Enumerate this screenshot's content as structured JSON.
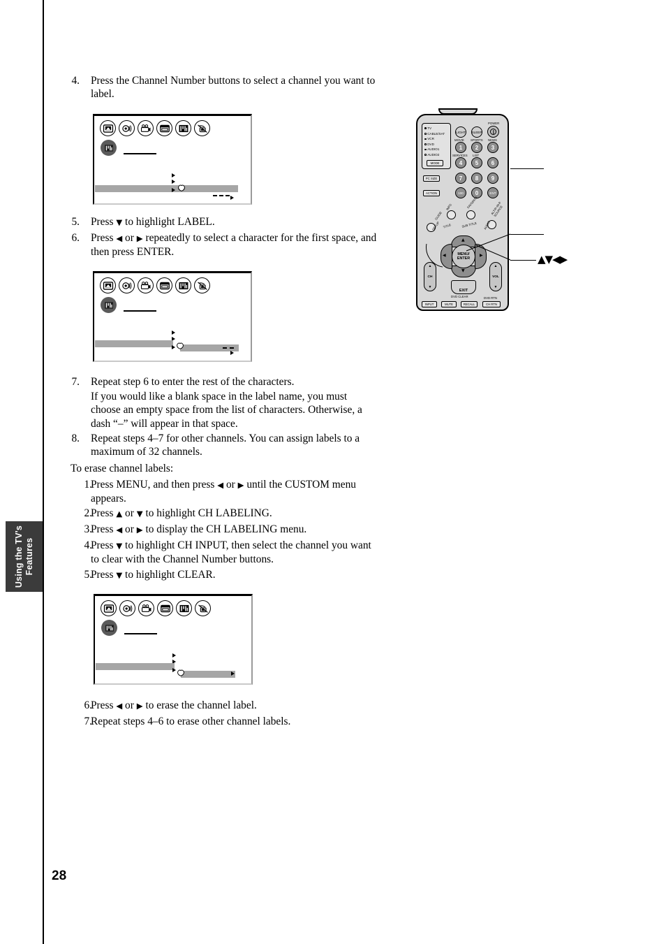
{
  "page": {
    "number": "28",
    "side_tab": "Using the TV's\nFeatures"
  },
  "steps_label": {
    "s4_num": "4.",
    "s4_text": "Press the Channel Number buttons to select a channel you want to label.",
    "s5_num": "5.",
    "s5_text_a": "Press ",
    "s5_arrow": "▼",
    "s5_text_b": " to highlight LABEL.",
    "s6_num": "6.",
    "s6_text_a": "Press ",
    "s6_arrow_l": "◀",
    "s6_text_b": " or ",
    "s6_arrow_r": "▶",
    "s6_text_c": " repeatedly to select a character for the first space, and then press ENTER.",
    "s7_num": "7.",
    "s7_text": "Repeat step 6 to enter the rest of the characters.",
    "s7_note": "If you would like a blank space in the label name, you must choose an empty space from the list of characters. Otherwise, a dash “–” will appear in that space.",
    "s8_num": "8.",
    "s8_text": "Repeat steps 4–7 for other channels. You can assign labels to a maximum of 32 channels."
  },
  "erase_section": {
    "heading": "To erase channel labels:",
    "e1_num": "1.",
    "e1_a": "Press MENU, and then press ",
    "e1_arrow_l": "◀",
    "e1_b": " or ",
    "e1_arrow_r": "▶",
    "e1_c": " until the CUSTOM menu appears.",
    "e2_num": "2.",
    "e2_a": "Press ",
    "e2_arrow_u": "▲",
    "e2_b": " or ",
    "e2_arrow_d": "▼",
    "e2_c": " to highlight CH LABELING.",
    "e3_num": "3.",
    "e3_a": "Press ",
    "e3_arrow_l": "◀",
    "e3_b": " or ",
    "e3_arrow_r": "▶",
    "e3_c": " to display the CH LABELING menu.",
    "e4_num": "4.",
    "e4_a": "Press ",
    "e4_arrow_d": "▼",
    "e4_b": " to highlight CH INPUT, then select the channel you want to clear with the Channel Number buttons.",
    "e5_num": "5.",
    "e5_a": "Press ",
    "e5_arrow_d": "▼",
    "e5_b": " to highlight CLEAR.",
    "e6_num": "6.",
    "e6_a": "Press ",
    "e6_arrow_l": "◀",
    "e6_b": " or ",
    "e6_arrow_r": "▶",
    "e6_c": " to erase the channel label.",
    "e7_num": "7.",
    "e7_text": "Repeat steps 4–6 to erase other channel labels."
  },
  "menu_screens": [
    {
      "id": "screen-step4",
      "icons": [
        "picture-menu-icon",
        "audio-menu-icon",
        "video-menu-icon",
        "tv-setup-menu-icon",
        "custom-menu-icon",
        "lock-menu-icon"
      ],
      "selected_icon_index": 4,
      "selected_icon_name": "custom-menu-icon"
    },
    {
      "id": "screen-step6",
      "icons": [
        "picture-menu-icon",
        "audio-menu-icon",
        "video-menu-icon",
        "tv-setup-menu-icon",
        "custom-menu-icon",
        "lock-menu-icon"
      ],
      "selected_icon_index": 4,
      "selected_icon_name": "custom-menu-icon"
    },
    {
      "id": "screen-erase-step5",
      "icons": [
        "picture-menu-icon",
        "audio-menu-icon",
        "video-menu-icon",
        "tv-setup-menu-icon",
        "custom-menu-icon",
        "lock-menu-icon"
      ],
      "selected_icon_index": 4,
      "selected_icon_name": "custom-menu-icon"
    }
  ],
  "remote": {
    "mode_list": [
      "TV",
      "CABLE/SAT",
      "VCR",
      "DVD",
      "AUDIO1",
      "AUDIO2"
    ],
    "mode_selected": "TV",
    "mode_button": "MODE",
    "pc_size_button": "PC SIZE",
    "action_button": "ACTION",
    "light_button": "LIGHT",
    "sleep_button": "SLEEP",
    "power_label": "POWER",
    "numpad_captions": {
      "c1": "MOVIE",
      "c2": "SPORTS",
      "c3": "NEWS",
      "c4": "SERVICES",
      "c5": "LIST"
    },
    "numpad": [
      "1",
      "2",
      "3",
      "4",
      "5",
      "6",
      "7",
      "8",
      "9",
      "100",
      "0",
      "ENT"
    ],
    "round_buttons": [
      "INFO",
      "FAVORITE",
      "ALT/P-IN-P SOURCE"
    ],
    "round_sub": [
      "TITLE",
      "SUB TITLE",
      "AUDIO"
    ],
    "guide_button": "GUIDE",
    "setup_button": "SETUP",
    "menu_enter": "MENU/\nENTER",
    "menu_line1": "MENU/",
    "menu_line2": "ENTER",
    "ch_rocker": "CH",
    "vol_rocker": "VOL",
    "exit_button": "EXIT",
    "dvd_clear": "DVD CLEAR",
    "bottom_buttons": [
      "INPUT",
      "MUTE",
      "RECALL",
      "CH RTN"
    ],
    "dvd_rtn": "DVD RTN",
    "callout_label": "▲▼◀▶"
  }
}
